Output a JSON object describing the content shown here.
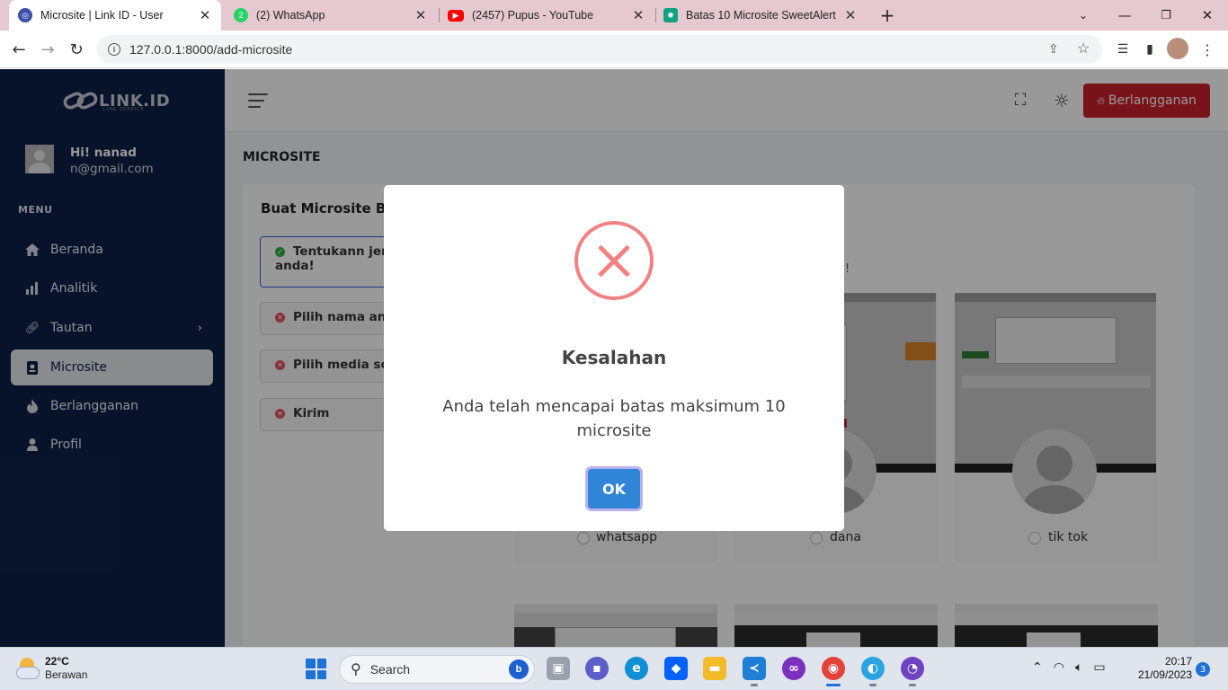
{
  "browser": {
    "tabs": [
      {
        "title": "Microsite | Link ID - User",
        "icon": "link-id-favicon",
        "color": "#3b4ea8"
      },
      {
        "title": "(2) WhatsApp",
        "icon": "whatsapp-favicon",
        "color": "#25d366"
      },
      {
        "title": "(2457) Pupus - YouTube",
        "icon": "youtube-favicon",
        "color": "#ff0000"
      },
      {
        "title": "Batas 10 Microsite SweetAlert",
        "icon": "chatgpt-favicon",
        "color": "#10a37f"
      }
    ],
    "url": "127.0.0.1:8000/add-microsite"
  },
  "sidebar": {
    "logo_text": "LINK.ID",
    "logo_sub": "LINK SERVICE",
    "greeting": "Hi! nanad",
    "email": "n@gmail.com",
    "menu_label": "MENU",
    "items": [
      {
        "label": "Beranda",
        "icon": "home-icon"
      },
      {
        "label": "Analitik",
        "icon": "chart-icon"
      },
      {
        "label": "Tautan",
        "icon": "link-icon"
      },
      {
        "label": "Microsite",
        "icon": "id-badge-icon"
      },
      {
        "label": "Berlangganan",
        "icon": "fire-icon"
      },
      {
        "label": "Profil",
        "icon": "user-icon"
      }
    ]
  },
  "header": {
    "subscribe_label": "Berlangganan"
  },
  "main": {
    "page_title": "MICROSITE",
    "card_title": "Buat Microsite Ba",
    "steps": [
      {
        "label": "Tentukann jeni",
        "label2": "anda!",
        "status": "done"
      },
      {
        "label": "Pilih nama and",
        "status": "error"
      },
      {
        "label": "Pilih media sos",
        "status": "error"
      },
      {
        "label": "Kirim",
        "status": "error"
      }
    ],
    "hint_tail": "a!",
    "templates": [
      {
        "label": "whatsapp"
      },
      {
        "label": "dana"
      },
      {
        "label": "tik tok"
      }
    ]
  },
  "modal": {
    "title": "Kesalahan",
    "text": "Anda telah mencapai batas maksimum 10 microsite",
    "ok_label": "OK"
  },
  "taskbar": {
    "temp": "22°C",
    "weather": "Berawan",
    "search_label": "Search",
    "time": "20:17",
    "date": "21/09/2023",
    "notifications": "3"
  }
}
